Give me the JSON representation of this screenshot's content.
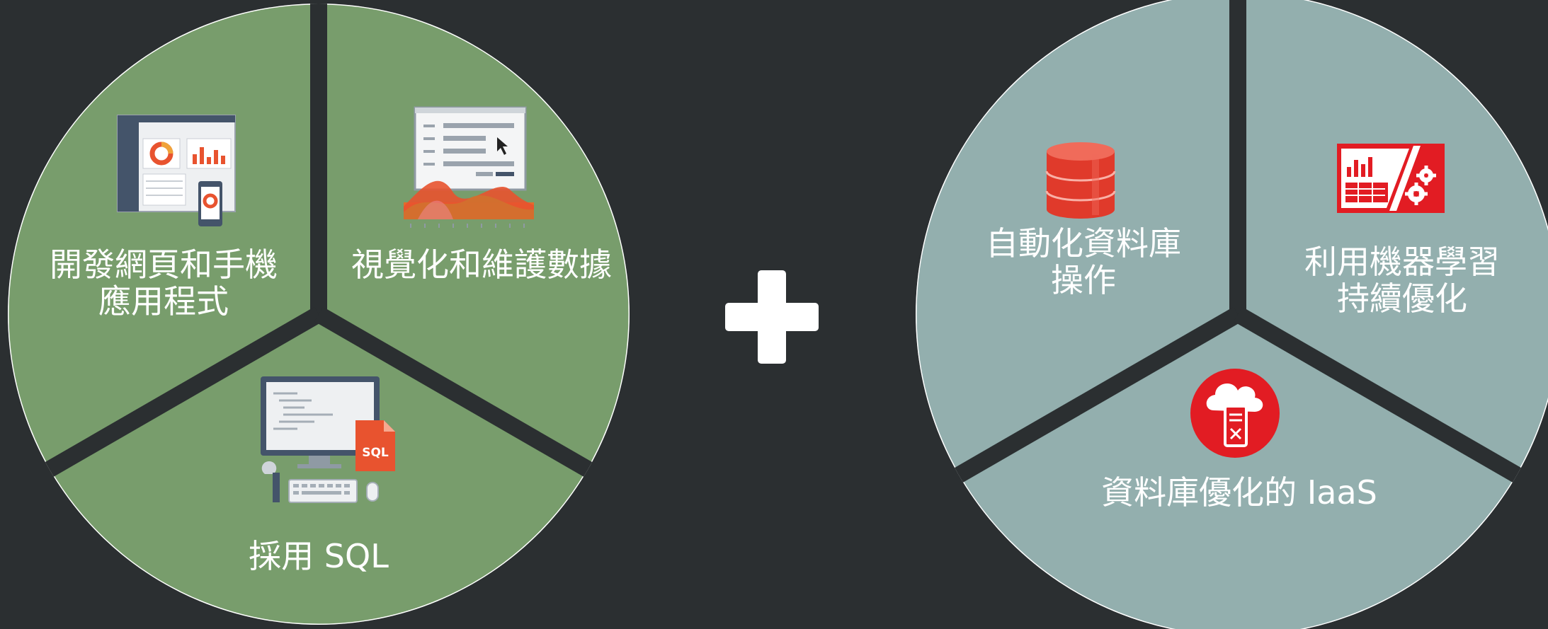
{
  "colors": {
    "background": "#2b2f31",
    "left_fill": "#789d6c",
    "right_fill": "#93afae",
    "accent_red": "#e21c23",
    "white": "#ffffff"
  },
  "left_group": {
    "segments": [
      {
        "lines": [
          "開發網頁和手機",
          "應用程式"
        ],
        "icon": "web-mobile-dashboard-icon"
      },
      {
        "lines": [
          "視覺化和維護數據"
        ],
        "icon": "data-visualization-icon"
      },
      {
        "lines": [
          "採用 SQL"
        ],
        "icon": "sql-workstation-icon"
      }
    ]
  },
  "operator": {
    "icon": "plus-icon"
  },
  "right_group": {
    "segments": [
      {
        "lines": [
          "自動化資料庫",
          "操作"
        ],
        "icon": "database-icon"
      },
      {
        "lines": [
          "利用機器學習",
          "持續優化"
        ],
        "icon": "machine-learning-icon"
      },
      {
        "lines": [
          "資料庫優化的 IaaS"
        ],
        "icon": "cloud-server-icon"
      }
    ]
  }
}
